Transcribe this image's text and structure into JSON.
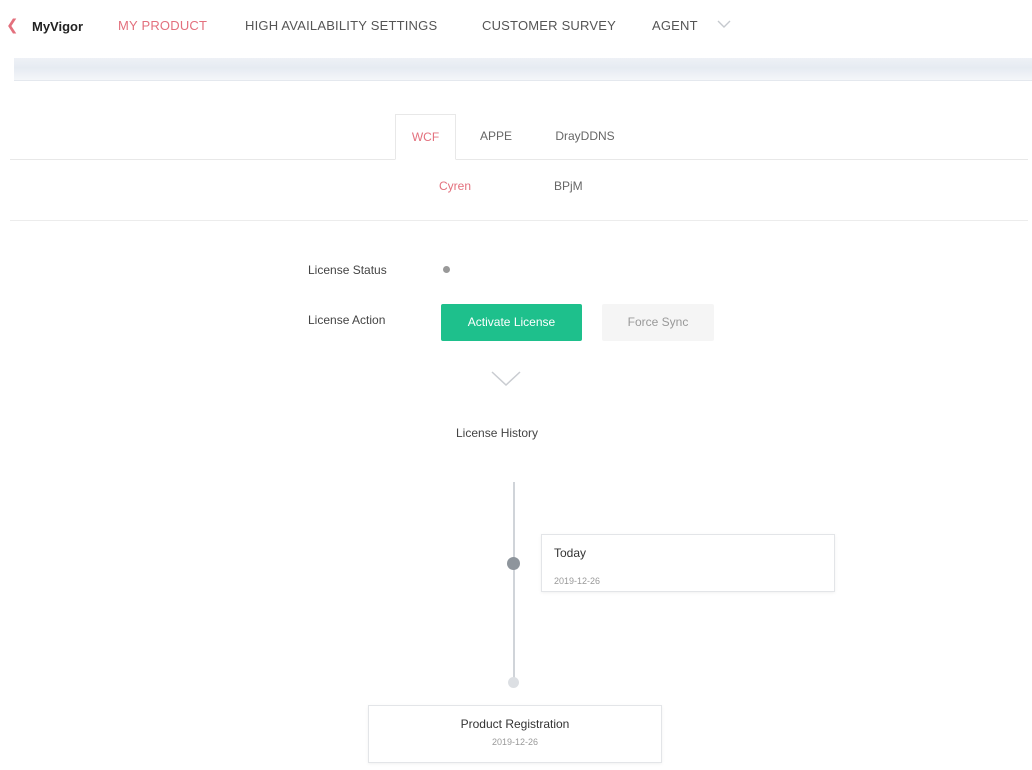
{
  "nav": {
    "brand": "MyVigor",
    "items": [
      {
        "label": "MY PRODUCT",
        "active": true
      },
      {
        "label": "HIGH AVAILABILITY SETTINGS",
        "active": false
      },
      {
        "label": "CUSTOMER SURVEY",
        "active": false
      },
      {
        "label": "AGENT",
        "active": false
      }
    ],
    "agent_icon": "chevron-down-icon"
  },
  "tabs": [
    {
      "label": "WCF",
      "active": true
    },
    {
      "label": "APPE",
      "active": false
    },
    {
      "label": "DrayDDNS",
      "active": false
    }
  ],
  "subtabs": [
    {
      "label": "Cyren",
      "active": true
    },
    {
      "label": "BPjM",
      "active": false
    }
  ],
  "license": {
    "status_label": "License Status",
    "status_color": "#999999",
    "action_label": "License Action",
    "activate_label": "Activate License",
    "sync_label": "Force Sync",
    "expand_icon": "chevron-down-icon",
    "history_title": "License History"
  },
  "timeline": [
    {
      "title": "Today",
      "date": "2019-12-26"
    },
    {
      "title": "Product Registration",
      "date": "2019-12-26"
    }
  ],
  "colors": {
    "accent": "#e3707d",
    "primary_button": "#1ec08c"
  }
}
